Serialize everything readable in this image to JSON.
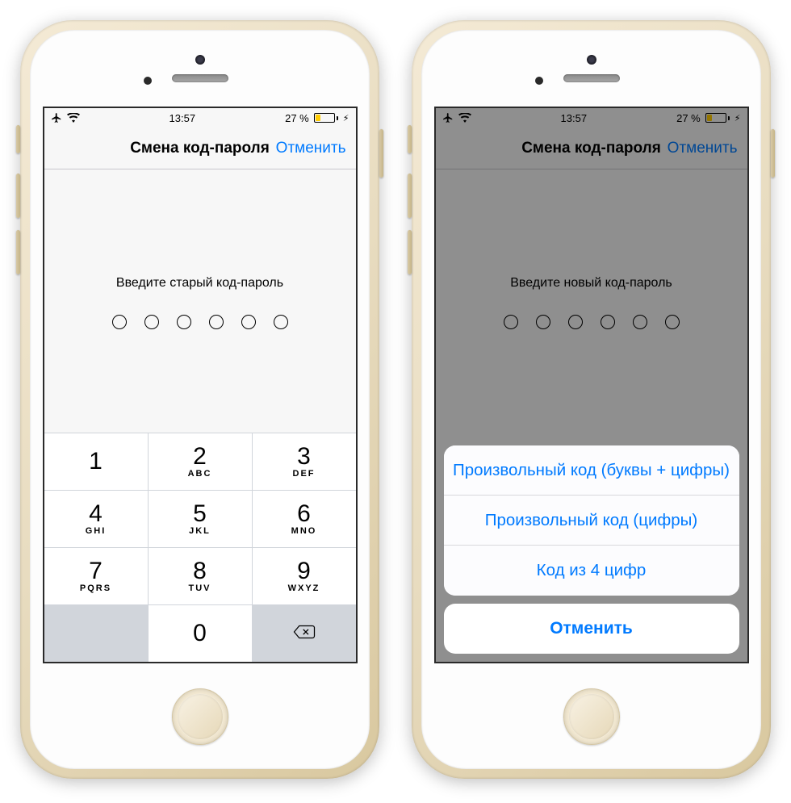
{
  "status": {
    "time": "13:57",
    "battery_pct": "27 %"
  },
  "left": {
    "nav_title": "Смена код-пароля",
    "nav_cancel": "Отменить",
    "prompt": "Введите старый код-пароль",
    "keypad": [
      {
        "num": "1",
        "let": ""
      },
      {
        "num": "2",
        "let": "ABC"
      },
      {
        "num": "3",
        "let": "DEF"
      },
      {
        "num": "4",
        "let": "GHI"
      },
      {
        "num": "5",
        "let": "JKL"
      },
      {
        "num": "6",
        "let": "MNO"
      },
      {
        "num": "7",
        "let": "PQRS"
      },
      {
        "num": "8",
        "let": "TUV"
      },
      {
        "num": "9",
        "let": "WXYZ"
      },
      {
        "num": "0",
        "let": ""
      }
    ]
  },
  "right": {
    "nav_title": "Смена код-пароля",
    "nav_cancel": "Отменить",
    "prompt": "Введите новый код-пароль",
    "sheet": {
      "opt1": "Произвольный код (буквы + цифры)",
      "opt2": "Произвольный код (цифры)",
      "opt3": "Код из 4 цифр",
      "cancel": "Отменить"
    }
  }
}
